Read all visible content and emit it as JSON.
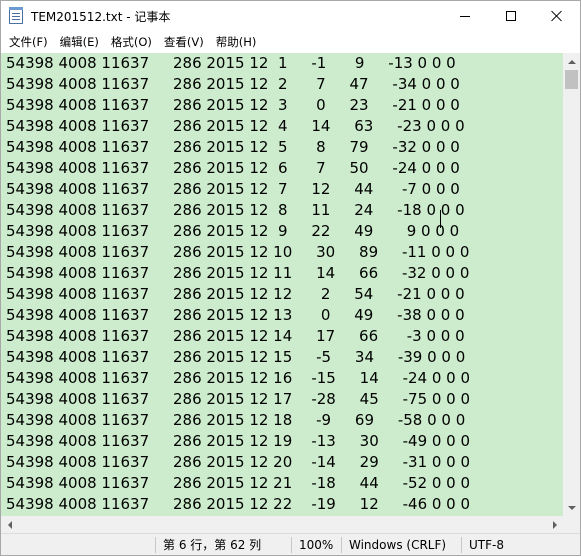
{
  "window": {
    "title": "TEM201512.txt - 记事本"
  },
  "icons": {
    "app": "notepad-icon",
    "minimize": "minimize-icon",
    "maximize": "maximize-icon",
    "close": "close-icon"
  },
  "menu": [
    "文件(F)",
    "编辑(E)",
    "格式(O)",
    "查看(V)",
    "帮助(H)"
  ],
  "editor": {
    "background": "#cdeccd",
    "lines": [
      "54398 4008 11637     286 2015 12  1     -1      9     -13 0 0 0",
      "54398 4008 11637     286 2015 12  2      7     47     -34 0 0 0",
      "54398 4008 11637     286 2015 12  3      0     23     -21 0 0 0",
      "54398 4008 11637     286 2015 12  4     14     63     -23 0 0 0",
      "54398 4008 11637     286 2015 12  5      8     79     -32 0 0 0",
      "54398 4008 11637     286 2015 12  6      7     50     -24 0 0 0",
      "54398 4008 11637     286 2015 12  7     12     44      -7 0 0 0",
      "54398 4008 11637     286 2015 12  8     11     24     -18 0 0 0",
      "54398 4008 11637     286 2015 12  9     22     49       9 0 0 0",
      "54398 4008 11637     286 2015 12 10     30     89     -11 0 0 0",
      "54398 4008 11637     286 2015 12 11     14     66     -32 0 0 0",
      "54398 4008 11637     286 2015 12 12      2     54     -21 0 0 0",
      "54398 4008 11637     286 2015 12 13      0     49     -38 0 0 0",
      "54398 4008 11637     286 2015 12 14     17     66      -3 0 0 0",
      "54398 4008 11637     286 2015 12 15     -5     34     -39 0 0 0",
      "54398 4008 11637     286 2015 12 16    -15     14     -24 0 0 0",
      "54398 4008 11637     286 2015 12 17    -28     45     -75 0 0 0",
      "54398 4008 11637     286 2015 12 18     -9     69     -58 0 0 0",
      "54398 4008 11637     286 2015 12 19    -13     30     -49 0 0 0",
      "54398 4008 11637     286 2015 12 20    -14     29     -31 0 0 0",
      "54398 4008 11637     286 2015 12 21    -18     44     -52 0 0 0",
      "54398 4008 11637     286 2015 12 22    -19     12     -46 0 0 0"
    ]
  },
  "status": {
    "position": "第 6 行，第 62 列",
    "zoom": "100%",
    "line_ending": "Windows (CRLF)",
    "encoding": "UTF-8"
  }
}
